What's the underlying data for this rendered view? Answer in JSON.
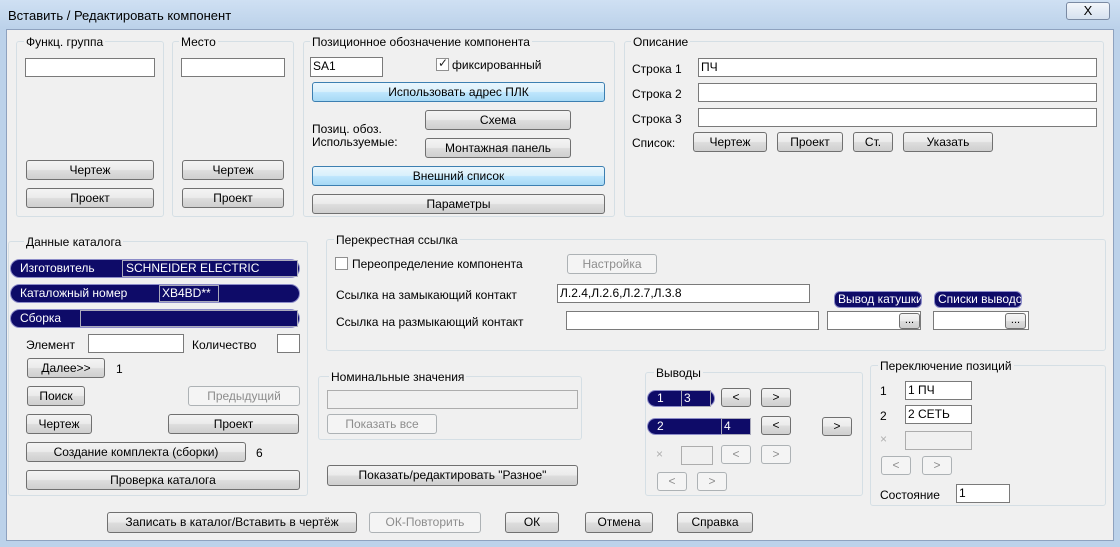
{
  "window": {
    "title": "Вставить / Редактировать компонент",
    "close_glyph": "X"
  },
  "func_group": {
    "label": "Функц. группа",
    "value": "",
    "drawing_btn": "Чертеж",
    "project_btn": "Проект"
  },
  "location": {
    "label": "Место",
    "value": "",
    "drawing_btn": "Чертеж",
    "project_btn": "Проект"
  },
  "tag": {
    "label": "Позиционное обозначение компонента",
    "value": "SA1",
    "fixed_label": "фиксированный",
    "fixed_checked": true,
    "use_plc_btn": "Использовать адрес ПЛК",
    "used_label_1": "Позиц. обоз.",
    "used_label_2": "Используемые:",
    "schematic_btn": "Схема",
    "panel_btn": "Монтажная панель",
    "external_list_btn": "Внешний список",
    "options_btn": "Параметры"
  },
  "description": {
    "label": "Описание",
    "line1_label": "Строка 1",
    "line1_value": "ПЧ",
    "line2_label": "Строка 2",
    "line2_value": "",
    "line3_label": "Строка 3",
    "line3_value": "",
    "list_label": "Список:",
    "drawing_btn": "Чертеж",
    "project_btn": "Проект",
    "std_btn": "Ст.",
    "pick_btn": "Указать"
  },
  "catalog": {
    "label": "Данные каталога",
    "manufacturer_label": "Изготовитель",
    "manufacturer_value": "SCHNEIDER ELECTRIC",
    "catalog_label": "Каталожный номер",
    "catalog_value": "XB4BD**",
    "assembly_label": "Сборка",
    "assembly_value": "",
    "item_label": "Элемент",
    "item_value": "",
    "count_label": "Количество",
    "count_value": "",
    "next_btn": "Далее>>",
    "next_count": "1",
    "lookup_btn": "Поиск",
    "previous_btn": "Предыдущий",
    "drawing_btn": "Чертеж",
    "project_btn": "Проект",
    "multiple_btn": "Создание комплекта (сборки)",
    "multiple_count": "6",
    "check_btn": "Проверка каталога"
  },
  "xref": {
    "label": "Перекрестная ссылка",
    "override_label": "Переопределение компонента",
    "override_checked": false,
    "setup_btn": "Настройка",
    "no_label": "Ссылка на замыкающий контакт",
    "no_value": "Л.2.4,Л.2.6,Л.2.7,Л.3.8",
    "nc_label": "Ссылка на размыкающий контакт",
    "nc_value": "",
    "coil_pill": "Вывод катушки",
    "pins_pill": "Списки выводов",
    "coil_value": "",
    "pins_value": "",
    "browse_btn": "..."
  },
  "ratings": {
    "label": "Номинальные значения",
    "value": "",
    "show_all_btn": "Показать все"
  },
  "misc_btn": "Показать/редактировать \"Разное\"",
  "pins": {
    "label": "Выводы",
    "row1_num": "1",
    "row1_value": "3",
    "row2_num": "2",
    "row2_value": "4",
    "row3_mark": "×",
    "row3_value": "",
    "left": "<",
    "right": ">"
  },
  "positions": {
    "label": "Переключение позиций",
    "p1_num": "1",
    "p1_value": "1 ПЧ",
    "p2_num": "2",
    "p2_value": "2 СЕТЬ",
    "p3_mark": "×",
    "p3_value": "",
    "left": "<",
    "right": ">",
    "state_label": "Состояние",
    "state_value": "1"
  },
  "footer": {
    "save_btn": "Записать в каталог/Вставить в чертёж",
    "ok_repeat_btn": "ОК-Повторить",
    "ok_btn": "ОК",
    "cancel_btn": "Отмена",
    "help_btn": "Справка"
  }
}
